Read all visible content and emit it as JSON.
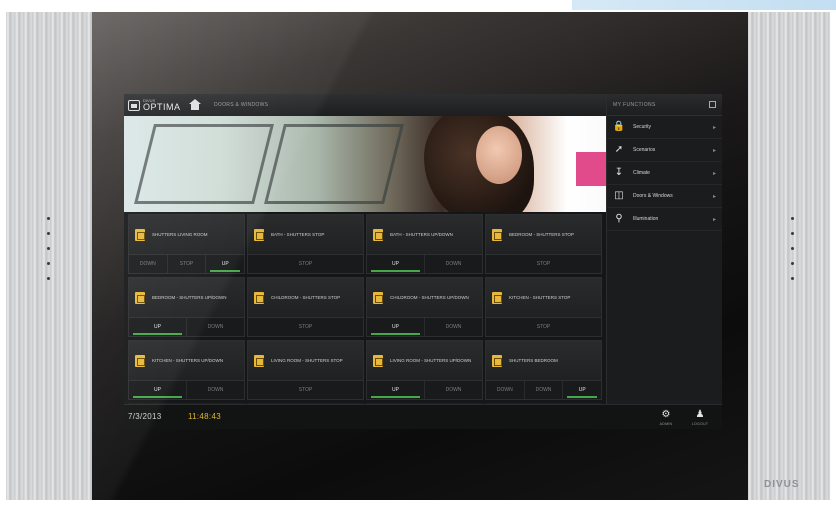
{
  "header": {
    "logo_small": "DIVUS",
    "logo_big": "OPTIMA",
    "breadcrumb": "DOORS & WINDOWS"
  },
  "sidebar": {
    "title": "MY FUNCTIONS",
    "items": [
      {
        "label": "Security",
        "icon": "lock-icon"
      },
      {
        "label": "Scenarios",
        "icon": "wand-icon"
      },
      {
        "label": "Climate",
        "icon": "thermometer-icon"
      },
      {
        "label": "Doors & Windows",
        "icon": "door-icon"
      },
      {
        "label": "Illumination",
        "icon": "bulb-icon"
      }
    ]
  },
  "tiles": [
    {
      "name": "SHUTTERS LIVING ROOM",
      "buttons": [
        "DOWN",
        "STOP",
        "UP"
      ]
    },
    {
      "name": "BATH - SHUTTERS STOP",
      "buttons": [
        "STOP"
      ]
    },
    {
      "name": "BATH - SHUTTERS UP/DOWN",
      "buttons": [
        "UP",
        "DOWN"
      ]
    },
    {
      "name": "BEDROOM - SHUTTERS STOP",
      "buttons": [
        "STOP"
      ]
    },
    {
      "name": "BEDROOM - SHUTTERS UP/DOWN",
      "buttons": [
        "UP",
        "DOWN"
      ]
    },
    {
      "name": "CHILDROOM - SHUTTERS STOP",
      "buttons": [
        "STOP"
      ]
    },
    {
      "name": "CHILDROOM - SHUTTERS UP/DOWN",
      "buttons": [
        "UP",
        "DOWN"
      ]
    },
    {
      "name": "KITCHEN - SHUTTERS STOP",
      "buttons": [
        "STOP"
      ]
    },
    {
      "name": "KITCHEN - SHUTTERS UP/DOWN",
      "buttons": [
        "UP",
        "DOWN"
      ]
    },
    {
      "name": "LIVING ROOM - SHUTTERS STOP",
      "buttons": [
        "STOP"
      ]
    },
    {
      "name": "LIVING ROOM - SHUTTERS UP/DOWN",
      "buttons": [
        "UP",
        "DOWN"
      ]
    },
    {
      "name": "SHUTTERS BEDROOM",
      "buttons": [
        "DOWN",
        "DOWN",
        "UP"
      ]
    }
  ],
  "status": {
    "date": "7/3/2013",
    "time": "11:48:43",
    "admin_label": "ADMIN",
    "logout_label": "LOGOUT"
  },
  "brand": "DIVUS",
  "colors": {
    "accent_yellow": "#e8b938",
    "up_green": "#47a84a",
    "down_red": "#b63b3b"
  }
}
